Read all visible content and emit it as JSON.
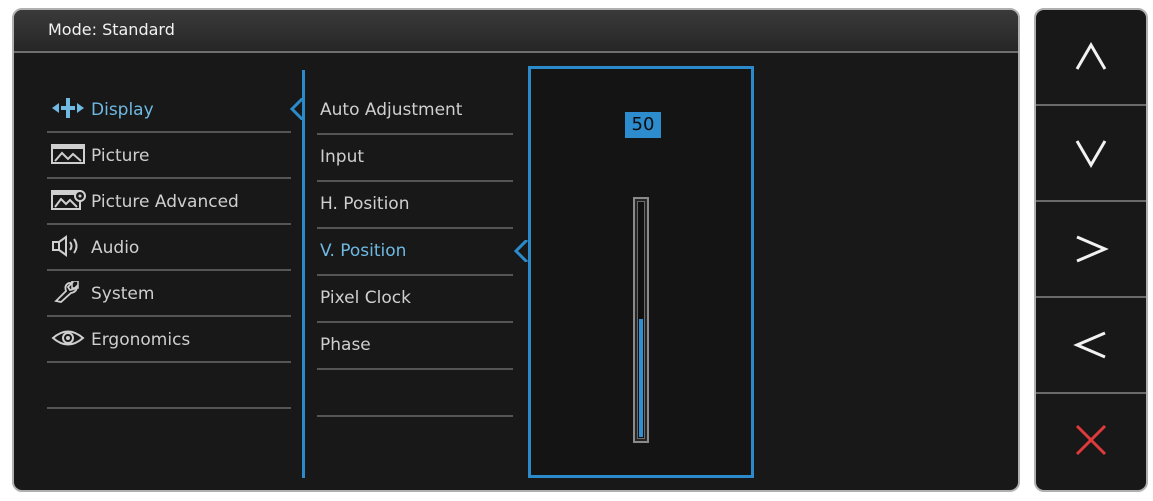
{
  "header": {
    "mode_label": "Mode: Standard"
  },
  "main_menu": {
    "items": [
      {
        "label": "Display",
        "icon": "display-icon",
        "active": true
      },
      {
        "label": "Picture",
        "icon": "picture-icon",
        "active": false
      },
      {
        "label": "Picture Advanced",
        "icon": "picture-advanced-icon",
        "active": false
      },
      {
        "label": "Audio",
        "icon": "audio-icon",
        "active": false
      },
      {
        "label": "System",
        "icon": "system-icon",
        "active": false
      },
      {
        "label": "Ergonomics",
        "icon": "ergonomics-icon",
        "active": false
      }
    ]
  },
  "sub_menu": {
    "items": [
      {
        "label": "Auto Adjustment",
        "active": false
      },
      {
        "label": "Input",
        "active": false
      },
      {
        "label": "H. Position",
        "active": false
      },
      {
        "label": "V. Position",
        "active": true
      },
      {
        "label": "Pixel Clock",
        "active": false
      },
      {
        "label": "Phase",
        "active": false
      }
    ]
  },
  "value_panel": {
    "value": "50",
    "level_fraction": 0.5
  },
  "control_keys": [
    {
      "icon": "up-chevron-icon"
    },
    {
      "icon": "down-chevron-icon"
    },
    {
      "icon": "right-chevron-icon"
    },
    {
      "icon": "left-chevron-icon"
    },
    {
      "icon": "close-icon"
    }
  ],
  "colors": {
    "accent": "#2b8ac9",
    "active_text": "#6fb9e3",
    "close": "#e03a3a",
    "text": "#cfcfcf",
    "panel_bg": "#181818"
  }
}
